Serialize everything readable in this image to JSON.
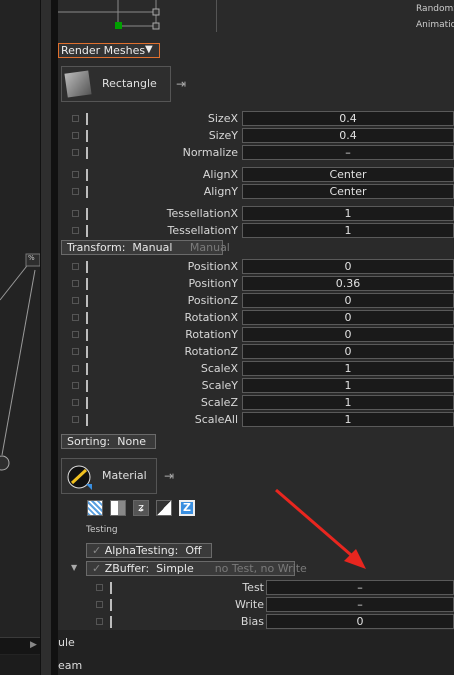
{
  "header": {
    "render_meshes_label": "Render Meshes",
    "right_text_1": "RandomS",
    "right_text_2": "Animation"
  },
  "mesh": {
    "name": "Rectangle"
  },
  "group1": [
    {
      "label": "SizeX",
      "value": "0.4"
    },
    {
      "label": "SizeY",
      "value": "0.4"
    },
    {
      "label": "Normalize",
      "value": "–"
    }
  ],
  "group2": [
    {
      "label": "AlignX",
      "value": "Center"
    },
    {
      "label": "AlignY",
      "value": "Center"
    }
  ],
  "group3": [
    {
      "label": "TessellationX",
      "value": "1"
    },
    {
      "label": "TessellationY",
      "value": "1"
    }
  ],
  "transform": {
    "label": "Transform:",
    "value": "Manual",
    "ghost": "Manual"
  },
  "transform_rows": [
    {
      "label": "PositionX",
      "value": "0"
    },
    {
      "label": "PositionY",
      "value": "0.36"
    },
    {
      "label": "PositionZ",
      "value": "0"
    },
    {
      "label": "RotationX",
      "value": "0"
    },
    {
      "label": "RotationY",
      "value": "0"
    },
    {
      "label": "RotationZ",
      "value": "0"
    },
    {
      "label": "ScaleX",
      "value": "1"
    },
    {
      "label": "ScaleY",
      "value": "1"
    },
    {
      "label": "ScaleZ",
      "value": "1"
    },
    {
      "label": "ScaleAll",
      "value": "1"
    }
  ],
  "sorting": {
    "label": "Sorting:",
    "value": "None"
  },
  "material": {
    "name": "Material",
    "caption": "Testing"
  },
  "alpha_testing": {
    "label": "AlphaTesting:",
    "value": "Off"
  },
  "zbuffer": {
    "label": "ZBuffer:",
    "value": "Simple",
    "ghost": "no Test, no Write"
  },
  "zbuffer_rows": [
    {
      "label": "Test",
      "value": "–"
    },
    {
      "label": "Write",
      "value": "–"
    },
    {
      "label": "Bias",
      "value": "0"
    }
  ],
  "bottom": {
    "text1": "ule",
    "text2": "eam"
  },
  "graph_node_label": "%",
  "colors": {
    "accent_orange": "#e0702e",
    "arrow_red": "#e8261f",
    "node_green": "#00a000"
  }
}
